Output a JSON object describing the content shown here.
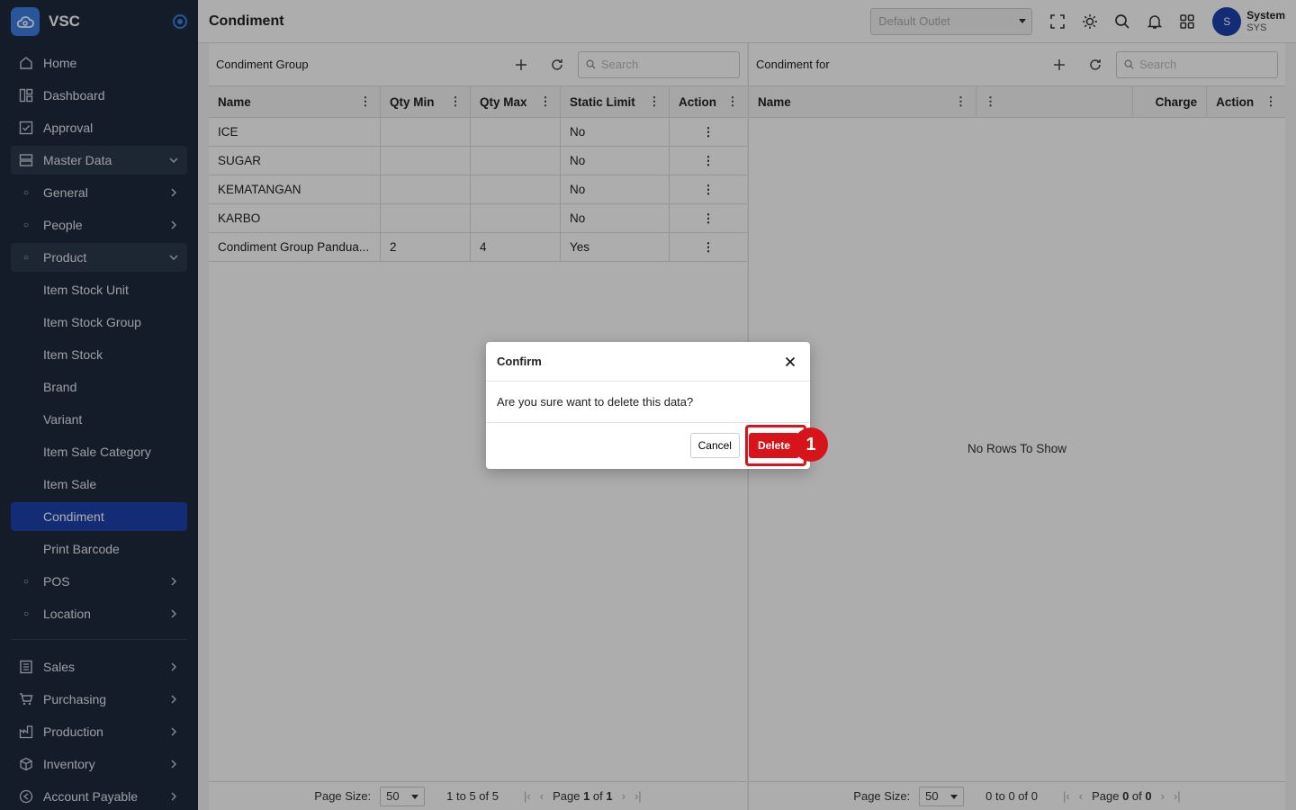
{
  "app": {
    "brand": "VSC",
    "page_title": "Condiment"
  },
  "header": {
    "outlet_placeholder": "Default Outlet",
    "user_initial": "S",
    "user_name": "System",
    "user_code": "SYS"
  },
  "sidebar": {
    "items": [
      {
        "label": "Home",
        "icon": "home-icon"
      },
      {
        "label": "Dashboard",
        "icon": "dashboard-icon"
      },
      {
        "label": "Approval",
        "icon": "approval-icon"
      },
      {
        "label": "Master Data",
        "icon": "database-icon"
      },
      {
        "label": "General"
      },
      {
        "label": "People"
      },
      {
        "label": "Product"
      },
      {
        "label": "Item Stock Unit"
      },
      {
        "label": "Item Stock Group"
      },
      {
        "label": "Item Stock"
      },
      {
        "label": "Brand"
      },
      {
        "label": "Variant"
      },
      {
        "label": "Item Sale Category"
      },
      {
        "label": "Item Sale"
      },
      {
        "label": "Condiment"
      },
      {
        "label": "Print Barcode"
      },
      {
        "label": "POS"
      },
      {
        "label": "Location"
      },
      {
        "label": "Sales",
        "icon": "sales-icon"
      },
      {
        "label": "Purchasing",
        "icon": "cart-icon"
      },
      {
        "label": "Production",
        "icon": "factory-icon"
      },
      {
        "label": "Inventory",
        "icon": "box-icon"
      },
      {
        "label": "Account Payable",
        "icon": "payable-icon"
      }
    ]
  },
  "left_panel": {
    "title": "Condiment Group",
    "search_placeholder": "Search",
    "columns": [
      "Name",
      "Qty Min",
      "Qty Max",
      "Static Limit",
      "Action"
    ],
    "rows": [
      {
        "name": "ICE",
        "qty_min": "",
        "qty_max": "",
        "static_limit": "No"
      },
      {
        "name": "SUGAR",
        "qty_min": "",
        "qty_max": "",
        "static_limit": "No"
      },
      {
        "name": "KEMATANGAN",
        "qty_min": "",
        "qty_max": "",
        "static_limit": "No"
      },
      {
        "name": "KARBO",
        "qty_min": "",
        "qty_max": "",
        "static_limit": "No"
      },
      {
        "name": "Condiment Group Pandua...",
        "qty_min": "2",
        "qty_max": "4",
        "static_limit": "Yes"
      }
    ],
    "pager": {
      "size_label": "Page Size:",
      "size": "50",
      "range": "1 to 5 of 5",
      "page_word": "Page",
      "page": "1",
      "of_word": "of",
      "total": "1"
    }
  },
  "right_panel": {
    "title": "Condiment for",
    "search_placeholder": "Search",
    "columns": [
      "Name",
      "",
      "Charge",
      "Action"
    ],
    "empty_text": "No Rows To Show",
    "pager": {
      "size_label": "Page Size:",
      "size": "50",
      "range": "0 to 0 of 0",
      "page_word": "Page",
      "page": "0",
      "of_word": "of",
      "total": "0"
    }
  },
  "dialog": {
    "title": "Confirm",
    "message": "Are you sure want to delete this data?",
    "cancel_label": "Cancel",
    "delete_label": "Delete",
    "step_badge": "1"
  },
  "colors": {
    "sidebar_bg": "#1e2a3e",
    "active": "#1e40af",
    "danger": "#d7141a"
  }
}
